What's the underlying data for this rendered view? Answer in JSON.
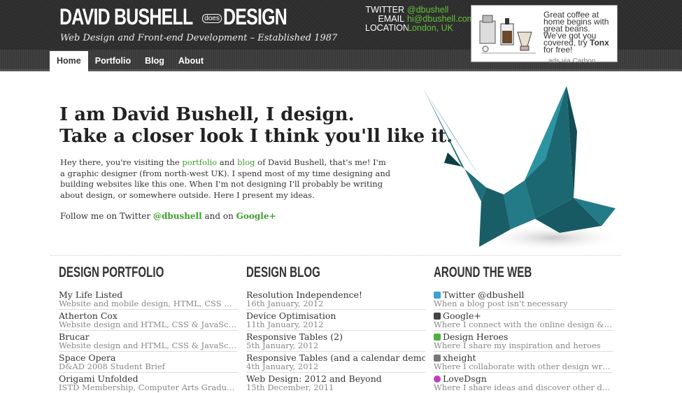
{
  "header": {
    "logo_part1": "DAVID BUSHELL",
    "logo_does": "does",
    "logo_part2": "DESIGN",
    "tagline": "Web Design and Front-end Development – Established 1987",
    "contact": [
      {
        "key": "TWITTER",
        "value": "@dbushell"
      },
      {
        "key": "EMAIL",
        "value": "hi@dbushell.com"
      },
      {
        "key": "LOCATION",
        "value": "London, UK"
      }
    ],
    "ad": {
      "text": "Great coffee at home begins with great beans. We've got you covered, try ",
      "brand": "Tonx",
      "text_end": " for free!",
      "via": "ads via Carbon"
    }
  },
  "nav": {
    "items": [
      "Home",
      "Portfolio",
      "Blog",
      "About"
    ],
    "active": "Home"
  },
  "intro": {
    "heading": "I am David Bushell, I design.",
    "subheading": "Take a closer look I think you'll like it.",
    "p1_a": "Hey there, you're visiting the ",
    "p1_link1": "portfolio",
    "p1_b": " and ",
    "p1_link2": "blog",
    "p1_c": " of David Bushell, that's me! I'm a graphic designer (from north-west UK). I spend most of my time designing and building websites like this one. When I'm not designing I'll probably be writing about design, or somewhere outside. Here I present my ideas.",
    "follow_a": "Follow me on Twitter ",
    "follow_link1": "@dbushell",
    "follow_b": " and on ",
    "follow_link2": "Google+"
  },
  "portfolio": {
    "title": "DESIGN PORTFOLIO",
    "items": [
      {
        "title": "My Life Listed",
        "sub": "Website and mobile design, HTML, CSS & J..."
      },
      {
        "title": "Atherton Cox",
        "sub": "Website design and HTML, CSS & JavaScrip..."
      },
      {
        "title": "Brucar",
        "sub": "Website design and HTML, CSS & JavaScrip..."
      },
      {
        "title": "Space Opera",
        "sub": "D&AD 2008 Student Brief"
      },
      {
        "title": "Origami Unfolded",
        "sub": "ISTD Membership, Computer Arts Graduate ..."
      }
    ]
  },
  "blog": {
    "title": "DESIGN BLOG",
    "items": [
      {
        "title": "Resolution Independence!",
        "sub": "16th January, 2012"
      },
      {
        "title": "Device Optimisation",
        "sub": "11th January, 2012"
      },
      {
        "title": "Responsive Tables (2)",
        "sub": "5th January, 2012"
      },
      {
        "title": "Responsive Tables (and a calendar demo)",
        "sub": "4th January, 2012"
      },
      {
        "title": "Web Design: 2012 and Beyond",
        "sub": "15th December, 2011"
      }
    ]
  },
  "web": {
    "title": "AROUND THE WEB",
    "items": [
      {
        "title": "Twitter @dbushell",
        "sub": "When a blog post isn't necessary",
        "icon": "twitter-icon",
        "color": "#3aa0d8"
      },
      {
        "title": "Google+",
        "sub": "Where I connect with the online design & de...",
        "icon": "google-plus-icon",
        "color": "#444444"
      },
      {
        "title": "Design Heroes",
        "sub": "Where I share my inspiration and heroes",
        "icon": "design-heroes-icon",
        "color": "#4db33d"
      },
      {
        "title": "xheight",
        "sub": "Where I collaborate with other design writers",
        "icon": "xheight-icon",
        "color": "#777777"
      },
      {
        "title": "LoveDsgn",
        "sub": "Where I share ideas and discover other desi...",
        "icon": "heart-icon",
        "color": "#c23cc2"
      }
    ]
  },
  "colors": {
    "accent": "#3d9e2b",
    "header_bg": "#2e2e2e",
    "crane": "#1d6f7a"
  }
}
